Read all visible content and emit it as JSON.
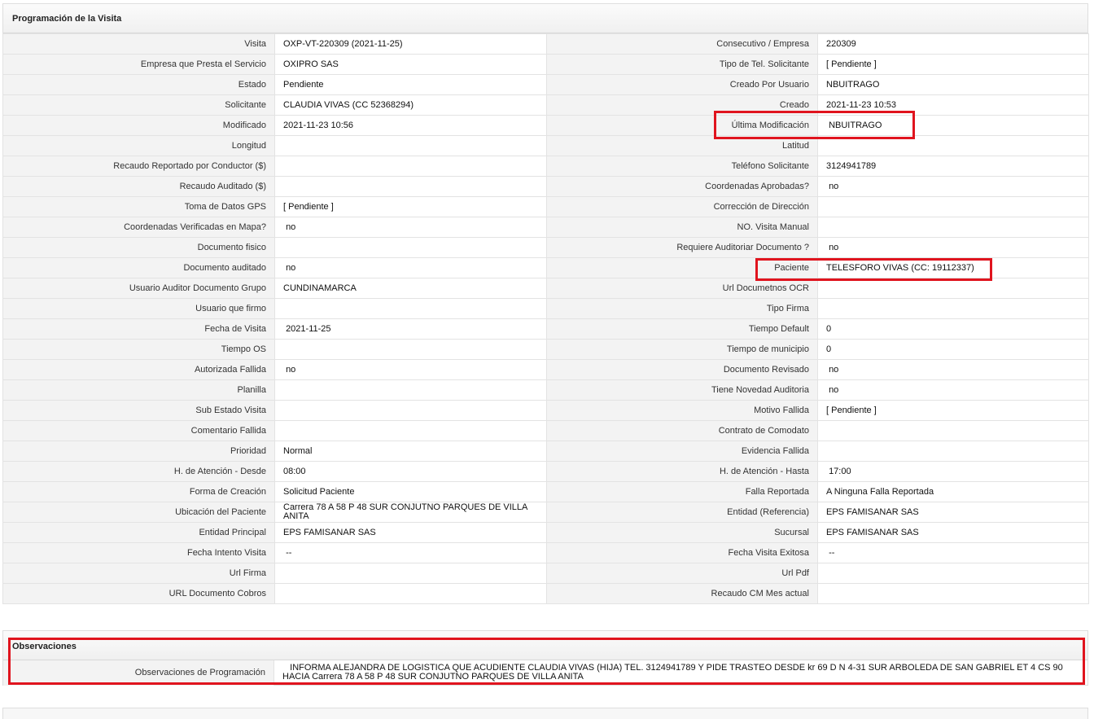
{
  "programacion": {
    "title": "Programación de la Visita",
    "rows": [
      [
        "Visita",
        "OXP-VT-220309 (2021-11-25)",
        "Consecutivo / Empresa",
        "220309"
      ],
      [
        "Empresa que Presta el Servicio",
        "OXIPRO SAS",
        "Tipo de Tel. Solicitante",
        "[ Pendiente ]"
      ],
      [
        "Estado",
        "Pendiente",
        "Creado Por Usuario",
        "NBUITRAGO"
      ],
      [
        "Solicitante",
        "CLAUDIA VIVAS (CC 52368294)",
        "Creado",
        "2021-11-23 10:53"
      ],
      [
        "Modificado",
        "2021-11-23 10:56",
        "Última Modificación",
        " NBUITRAGO"
      ],
      [
        "Longitud",
        "",
        "Latitud",
        ""
      ],
      [
        "Recaudo Reportado por Conductor ($)",
        "",
        "Teléfono Solicitante",
        "3124941789"
      ],
      [
        "Recaudo Auditado ($)",
        "",
        "Coordenadas Aprobadas?",
        " no"
      ],
      [
        "Toma de Datos GPS",
        "[ Pendiente ]",
        "Corrección de Dirección",
        ""
      ],
      [
        "Coordenadas Verificadas en Mapa?",
        " no",
        "NO. Visita Manual",
        ""
      ],
      [
        "Documento fisico",
        "",
        "Requiere Auditoriar Documento ?",
        " no"
      ],
      [
        "Documento auditado",
        " no",
        "Paciente",
        "TELESFORO VIVAS (CC: 19112337)"
      ],
      [
        "Usuario Auditor Documento Grupo",
        "CUNDINAMARCA",
        "Url Documetnos OCR",
        ""
      ],
      [
        "Usuario que firmo",
        "",
        "Tipo Firma",
        ""
      ],
      [
        "Fecha de Visita",
        " 2021-11-25",
        "Tiempo Default",
        "0"
      ],
      [
        "Tiempo OS",
        "",
        "Tiempo de municipio",
        "0"
      ],
      [
        "Autorizada Fallida",
        " no",
        "Documento Revisado",
        " no"
      ],
      [
        "Planilla",
        "",
        "Tiene Novedad Auditoria",
        " no"
      ],
      [
        "Sub Estado Visita",
        "",
        "Motivo Fallida",
        "[ Pendiente ]"
      ],
      [
        "Comentario Fallida",
        "",
        "Contrato de Comodato",
        ""
      ],
      [
        "Prioridad",
        "Normal",
        "Evidencia Fallida",
        ""
      ],
      [
        "H. de Atención - Desde",
        "08:00",
        "H. de Atención - Hasta",
        " 17:00"
      ],
      [
        "Forma de Creación",
        "Solicitud Paciente",
        "Falla Reportada",
        "A Ninguna Falla Reportada"
      ],
      [
        "Ubicación del Paciente",
        "Carrera 78 A 58 P 48 SUR CONJUTNO PARQUES DE VILLA ANITA",
        "Entidad (Referencia)",
        "EPS FAMISANAR SAS"
      ],
      [
        "Entidad Principal",
        "EPS FAMISANAR SAS",
        "Sucursal",
        "EPS FAMISANAR SAS"
      ],
      [
        "Fecha Intento Visita",
        " --",
        "Fecha Visita Exitosa",
        " --"
      ],
      [
        "Url Firma",
        "",
        "Url Pdf",
        ""
      ],
      [
        "URL Documento Cobros",
        "",
        "Recaudo CM Mes actual",
        ""
      ]
    ]
  },
  "observaciones": {
    "title": "Observaciones",
    "label": "Observaciones de Programación",
    "value": "   INFORMA ALEJANDRA DE LOGISTICA QUE ACUDIENTE CLAUDIA VIVAS (HIJA) TEL. 3124941789 Y PIDE TRASTEO DESDE kr 69 D N 4-31 SUR ARBOLEDA DE SAN GABRIEL ET 4 CS 90 HACIA Carrera 78 A 58 P 48 SUR CONJUTNO PARQUES DE VILLA ANITA"
  },
  "colors": {
    "highlight": "#e0141e",
    "label_bg": "#f3f3f3",
    "border": "#e3e3e3"
  }
}
